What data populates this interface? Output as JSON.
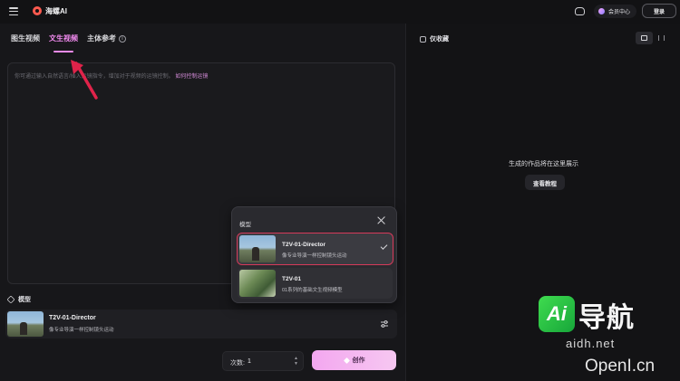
{
  "header": {
    "app_title": "海螺AI",
    "member_label": "会员中心",
    "login_label": "登录"
  },
  "tabs": [
    {
      "label": "图生视频",
      "active": false
    },
    {
      "label": "文生视频",
      "active": true
    },
    {
      "label": "主体参考",
      "active": false
    }
  ],
  "prompt": {
    "placeholder": "你可通过输入自然语言/插入运镜指令，增加对于视频的运镜控制。",
    "link_text": "如何控制运镜"
  },
  "model_section": {
    "label": "模型",
    "selected_name": "T2V-01-Director",
    "selected_desc": "像专业导演一样控制镜头运动"
  },
  "generation": {
    "count_label": "次数:",
    "count_value": "1",
    "create_label": "创作"
  },
  "model_dropdown": {
    "title": "模型",
    "options": [
      {
        "name": "T2V-01-Director",
        "desc": "像专业导演一样控制镜头运动",
        "selected": true
      },
      {
        "name": "T2V-01",
        "desc": "01系列的基础文生视频模型",
        "selected": false
      }
    ]
  },
  "right_panel": {
    "favorites_label": "仅收藏",
    "empty_text": "生成的作品将在这里展示",
    "tutorial_label": "查看教程"
  },
  "watermark": {
    "badge": "Ai",
    "brand": "导航",
    "domain": "aidh.net",
    "secondary": "OpenI.cn"
  },
  "colors": {
    "accent": "#f28bf0",
    "selection_outline": "#d63a5a",
    "background": "#121214"
  }
}
